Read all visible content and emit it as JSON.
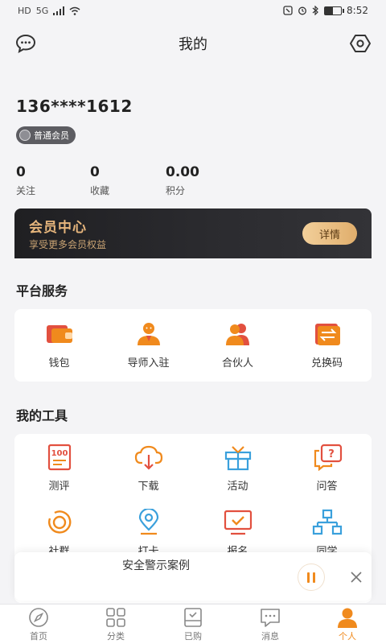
{
  "status_bar": {
    "left_icons": [
      "HD",
      "5G",
      "signal-icon",
      "wifi-icon"
    ],
    "right_icons": [
      "nfc-icon",
      "alarm-icon",
      "bluetooth-icon",
      "battery-icon"
    ],
    "battery_level": 0.5,
    "time": "8:52"
  },
  "nav": {
    "title": "我的",
    "left_icon": "chat-bubble-icon",
    "right_icon": "settings-hex-icon"
  },
  "profile": {
    "phone": "136****1612",
    "badge": "普通会员"
  },
  "stats": [
    {
      "value": "0",
      "label": "关注"
    },
    {
      "value": "0",
      "label": "收藏"
    },
    {
      "value": "0.00",
      "label": "积分"
    }
  ],
  "member_card": {
    "title": "会员中心",
    "subtitle": "享受更多会员权益",
    "button": "详情"
  },
  "platform": {
    "title": "平台服务",
    "items": [
      {
        "label": "钱包",
        "icon": "wallet-icon"
      },
      {
        "label": "导师入驻",
        "icon": "mentor-icon"
      },
      {
        "label": "合伙人",
        "icon": "partner-icon"
      },
      {
        "label": "兑换码",
        "icon": "exchange-code-icon"
      }
    ]
  },
  "tools": {
    "title": "我的工具",
    "items": [
      {
        "label": "测评",
        "icon": "evaluation-icon"
      },
      {
        "label": "下载",
        "icon": "download-cloud-icon"
      },
      {
        "label": "活动",
        "icon": "gift-box-icon"
      },
      {
        "label": "问答",
        "icon": "qa-icon"
      },
      {
        "label": "社群",
        "icon": "community-ring-icon"
      },
      {
        "label": "打卡",
        "icon": "location-pin-icon"
      },
      {
        "label": "报名",
        "icon": "signup-monitor-icon"
      },
      {
        "label": "同学",
        "icon": "classmates-tree-icon"
      }
    ]
  },
  "player": {
    "title": "安全警示案例"
  },
  "tabs": [
    {
      "label": "首页",
      "icon": "compass-icon",
      "active": false
    },
    {
      "label": "分类",
      "icon": "category-grid-icon",
      "active": false
    },
    {
      "label": "已购",
      "icon": "purchased-icon",
      "active": false
    },
    {
      "label": "消息",
      "icon": "message-icon",
      "active": false
    },
    {
      "label": "个人",
      "icon": "person-icon",
      "active": true
    }
  ],
  "colors": {
    "accent": "#f08a1d",
    "card_gold": "#e6b57c",
    "card_dark": "#2a2a2e",
    "tool_red": "#e2503f",
    "tool_orange": "#f08a1d",
    "tool_blue": "#3aa0dc"
  }
}
